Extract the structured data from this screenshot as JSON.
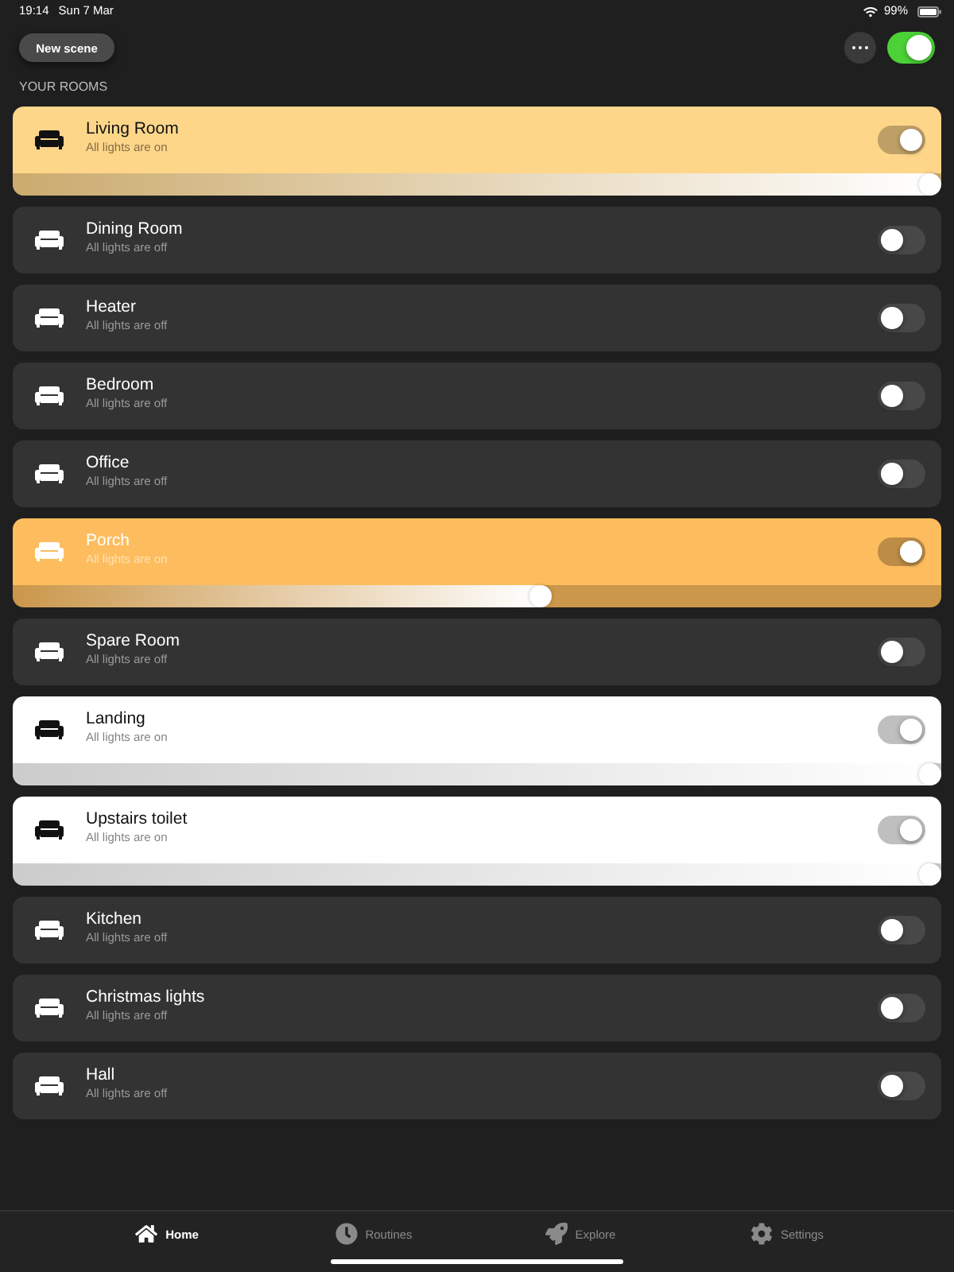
{
  "status_bar": {
    "time": "19:14",
    "date": "Sun 7 Mar",
    "battery": "99%"
  },
  "header": {
    "new_scene_button": "New scene",
    "master_switch": {
      "on": true
    }
  },
  "section_title": "YOUR ROOMS",
  "rooms": [
    {
      "name": "Living Room",
      "status": "All lights are on",
      "on": true,
      "color": "#fed68a",
      "level": 1
    },
    {
      "name": "Dining Room",
      "status": "All lights are off",
      "on": false
    },
    {
      "name": "Heater",
      "status": "All lights are off",
      "on": false
    },
    {
      "name": "Bedroom",
      "status": "All lights are off",
      "on": false
    },
    {
      "name": "Office",
      "status": "All lights are off",
      "on": false
    },
    {
      "name": "Porch",
      "status": "All lights are on",
      "on": true,
      "color": "#fdbd5e",
      "level": 0.57
    },
    {
      "name": "Spare Room",
      "status": "All lights are off",
      "on": false
    },
    {
      "name": "Landing",
      "status": "All lights are on",
      "on": true,
      "color": "#ffffff",
      "level": 1
    },
    {
      "name": "Upstairs toilet",
      "status": "All lights are on",
      "on": true,
      "color": "#ffffff",
      "level": 1
    },
    {
      "name": "Kitchen",
      "status": "All lights are off",
      "on": false
    },
    {
      "name": "Christmas lights",
      "status": "All lights are off",
      "on": false
    },
    {
      "name": "Hall",
      "status": "All lights are off",
      "on": false
    }
  ],
  "tabs": [
    {
      "label": "Home",
      "selected": true
    },
    {
      "label": "Routines",
      "selected": false
    },
    {
      "label": "Explore",
      "selected": false
    },
    {
      "label": "Settings",
      "selected": false
    }
  ]
}
